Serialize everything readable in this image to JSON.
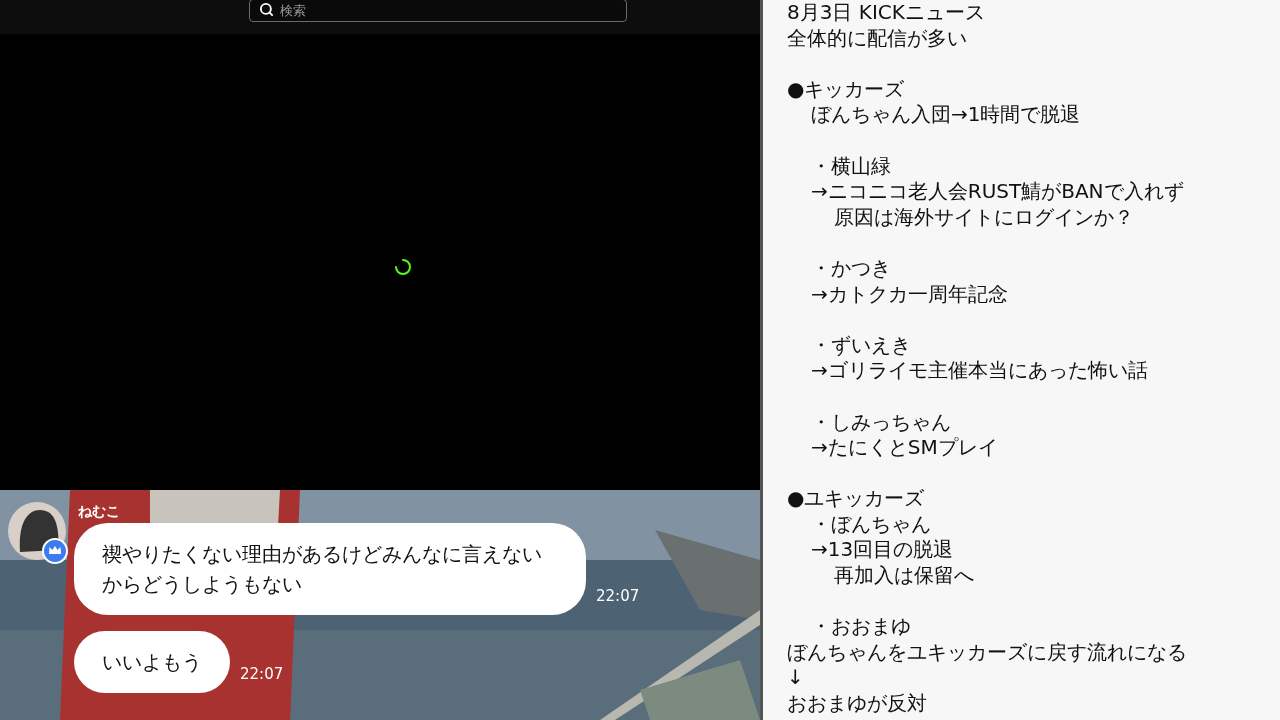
{
  "search": {
    "placeholder": "検索"
  },
  "player": {
    "loading": true
  },
  "chat": {
    "user": "ねむこ",
    "messages": [
      {
        "text": "禊やりたくない理由があるけどみんなに言えないからどうしようもない",
        "time": "22:07"
      },
      {
        "text": "いいよもう",
        "time": "22:07"
      }
    ]
  },
  "notes": [
    {
      "kind": "top",
      "text": "8月3日 KICKニュース"
    },
    {
      "kind": "top",
      "text": "全体的に配信が多い"
    },
    {
      "kind": "gap"
    },
    {
      "kind": "section",
      "text": "●キッカーズ"
    },
    {
      "kind": "entry",
      "text": "ぼんちゃん入団→1時間で脱退"
    },
    {
      "kind": "gap"
    },
    {
      "kind": "entry",
      "text": "・横山緑"
    },
    {
      "kind": "entry",
      "text": "→ニコニコ老人会RUST鯖がBANで入れず"
    },
    {
      "kind": "detail",
      "text": "原因は海外サイトにログインか？"
    },
    {
      "kind": "gap"
    },
    {
      "kind": "entry",
      "text": "・かつき"
    },
    {
      "kind": "entry",
      "text": "→カトクカ一周年記念"
    },
    {
      "kind": "gap"
    },
    {
      "kind": "entry",
      "text": "・ずいえき"
    },
    {
      "kind": "entry",
      "text": "→ゴリライモ主催本当にあった怖い話"
    },
    {
      "kind": "gap"
    },
    {
      "kind": "entry",
      "text": "・しみっちゃん"
    },
    {
      "kind": "entry",
      "text": "→たにくとSMプレイ"
    },
    {
      "kind": "gap"
    },
    {
      "kind": "section",
      "text": "●ユキッカーズ"
    },
    {
      "kind": "entry",
      "text": "・ぼんちゃん"
    },
    {
      "kind": "entry",
      "text": "→13回目の脱退"
    },
    {
      "kind": "detail",
      "text": "再加入は保留へ"
    },
    {
      "kind": "gap"
    },
    {
      "kind": "entry",
      "text": "・おおまゆ"
    },
    {
      "kind": "top",
      "text": "ぼんちゃんをユキッカーズに戻す流れになる"
    },
    {
      "kind": "top",
      "text": "↓"
    },
    {
      "kind": "top",
      "text": "おおまゆが反対"
    }
  ]
}
